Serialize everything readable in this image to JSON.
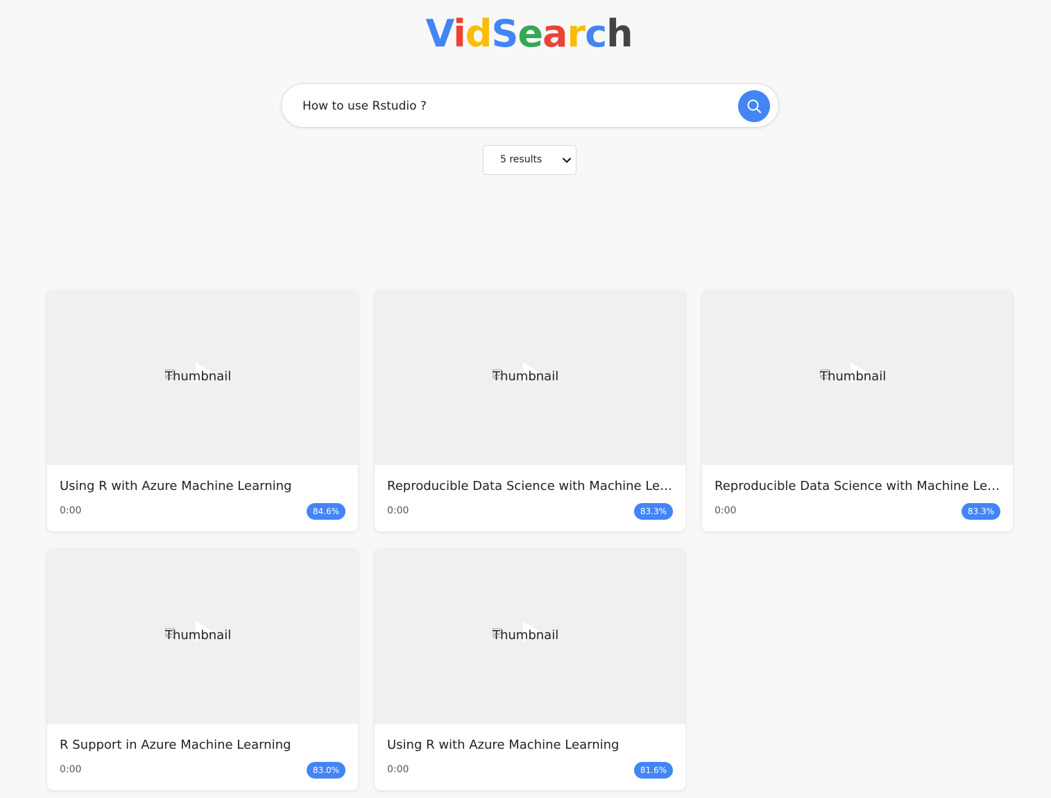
{
  "logo": {
    "letters": [
      {
        "char": "V",
        "color": "#4285f4"
      },
      {
        "char": "i",
        "color": "#ea4335"
      },
      {
        "char": "d",
        "color": "#fbbc05"
      },
      {
        "char": "S",
        "color": "#4285f4"
      },
      {
        "char": "e",
        "color": "#34a853"
      },
      {
        "char": "a",
        "color": "#ea4335"
      },
      {
        "char": "r",
        "color": "#fbbc05"
      },
      {
        "char": "c",
        "color": "#4285f4"
      },
      {
        "char": "h",
        "color": "#444444"
      }
    ]
  },
  "search": {
    "value": "How to use Rstudio ?",
    "button_icon": "search-icon",
    "accent": "#4285f4"
  },
  "results_select": {
    "selected": "5 results",
    "icon": "chevron-down-icon"
  },
  "results": [
    {
      "thumb_alt": "Thumbnail",
      "title": "Using R with Azure Machine Learning",
      "duration": "0:00",
      "score": "84.6%"
    },
    {
      "thumb_alt": "Thumbnail",
      "title": "Reproducible Data Science with Machine Learning",
      "duration": "0:00",
      "score": "83.3%"
    },
    {
      "thumb_alt": "Thumbnail",
      "title": "Reproducible Data Science with Machine Learning",
      "duration": "0:00",
      "score": "83.3%"
    },
    {
      "thumb_alt": "Thumbnail",
      "title": "R Support in Azure Machine Learning",
      "duration": "0:00",
      "score": "83.0%"
    },
    {
      "thumb_alt": "Thumbnail",
      "title": "Using R with Azure Machine Learning",
      "duration": "0:00",
      "score": "81.6%"
    }
  ]
}
